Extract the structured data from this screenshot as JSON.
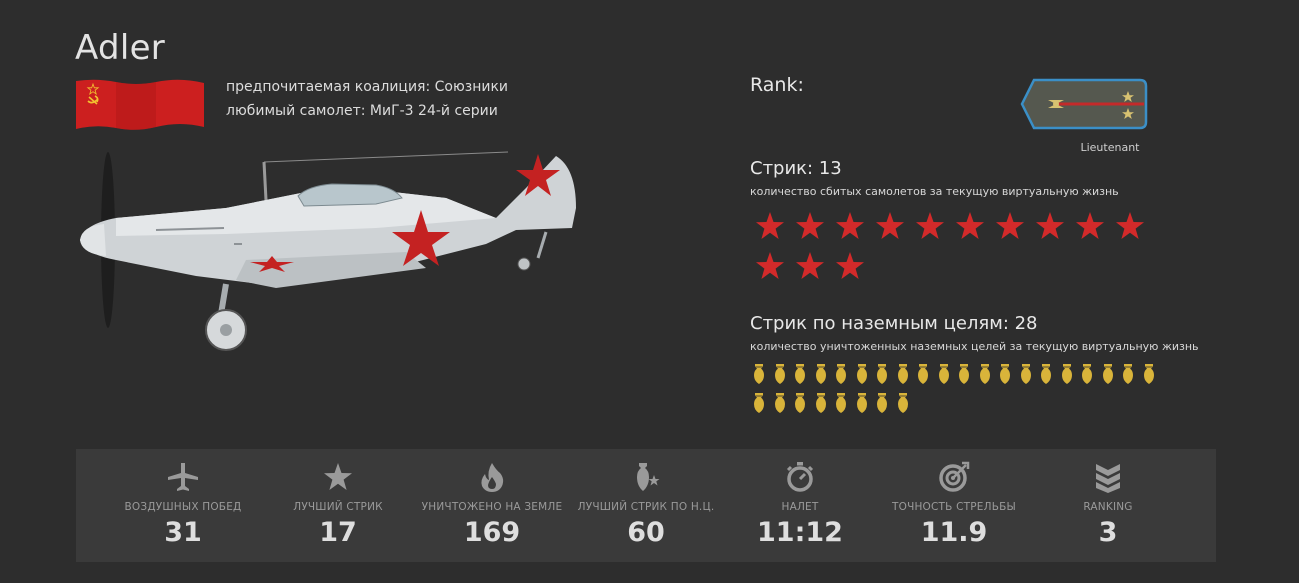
{
  "pilot": {
    "name": "Adler",
    "coalition_line": "предпочитаемая коалиция: Союзники",
    "plane_line": "любимый самолет: МиГ-3 24-й серии",
    "flag_icon": "ussr-flag-icon",
    "plane_icon": "mig-3-aircraft-icon"
  },
  "rank": {
    "label": "Rank:",
    "name": "Lieutenant",
    "icon": "epaulette-icon"
  },
  "air_streak": {
    "title": "Стрик: 13",
    "description": "количество сбитых самолетов за текущую виртуальную жизнь",
    "count": 13,
    "icon": "red-star-icon",
    "color": "#d32a2a"
  },
  "ground_streak": {
    "title": "Стрик по наземным целям: 28",
    "description": "количество уничтоженных наземных целей за текущую виртуальную жизнь",
    "count": 28,
    "icon": "bomb-icon",
    "color": "#d9b43a"
  },
  "stats": [
    {
      "icon": "plane-icon",
      "label": "воздушных побед",
      "value": "31"
    },
    {
      "icon": "star-icon",
      "label": "лучший стрик",
      "value": "17"
    },
    {
      "icon": "fire-icon",
      "label": "уничтожено на земле",
      "value": "169"
    },
    {
      "icon": "bomb-star-icon",
      "label": "лучший стрик по н.ц.",
      "value": "60"
    },
    {
      "icon": "stopwatch-icon",
      "label": "налет",
      "value": "11:12"
    },
    {
      "icon": "target-icon",
      "label": "точность стрельбы",
      "value": "11.9"
    },
    {
      "icon": "rank-chevron-icon",
      "label": "ranking",
      "value": "3"
    }
  ]
}
